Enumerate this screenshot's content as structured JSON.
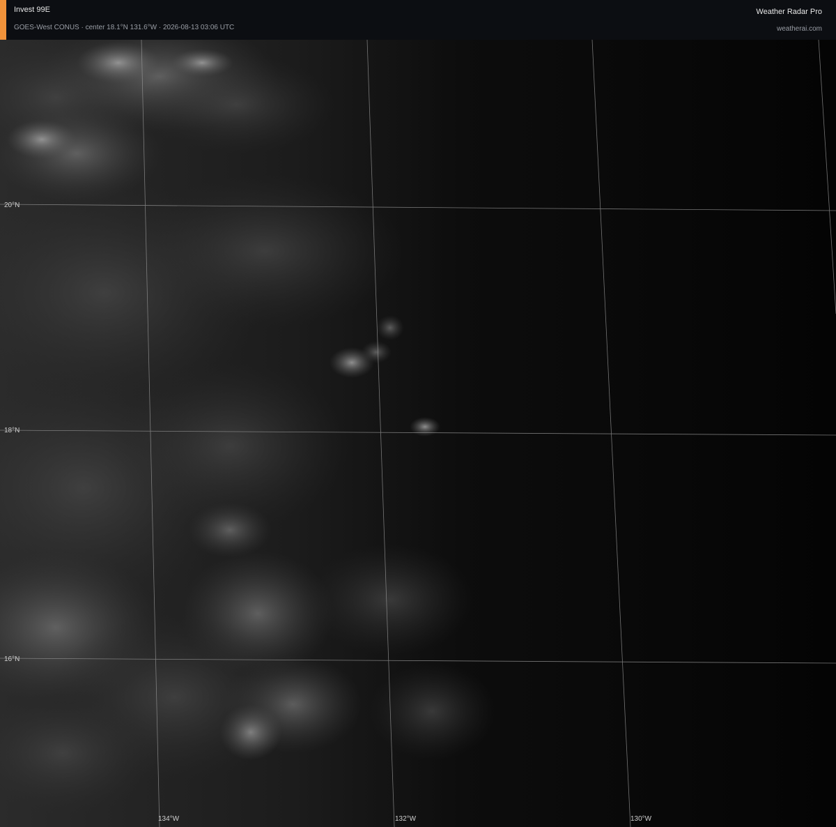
{
  "header": {
    "title": "Invest 99E",
    "subtitle": "GOES-West CONUS · center 18.1°N 131.6°W · 2026-08-13 03:06 UTC",
    "brand": "Weather Radar Pro",
    "site": "weatherai.com",
    "accent_color": "#f0923a"
  },
  "map": {
    "latitude_labels": [
      "20°N",
      "18°N",
      "16°N"
    ],
    "longitude_labels": [
      "134°W",
      "132°W",
      "130°W"
    ],
    "gridline_color": "#9a9a9a",
    "imagery": "visible satellite, scattered clouds thinning to clear ocean toward east"
  }
}
